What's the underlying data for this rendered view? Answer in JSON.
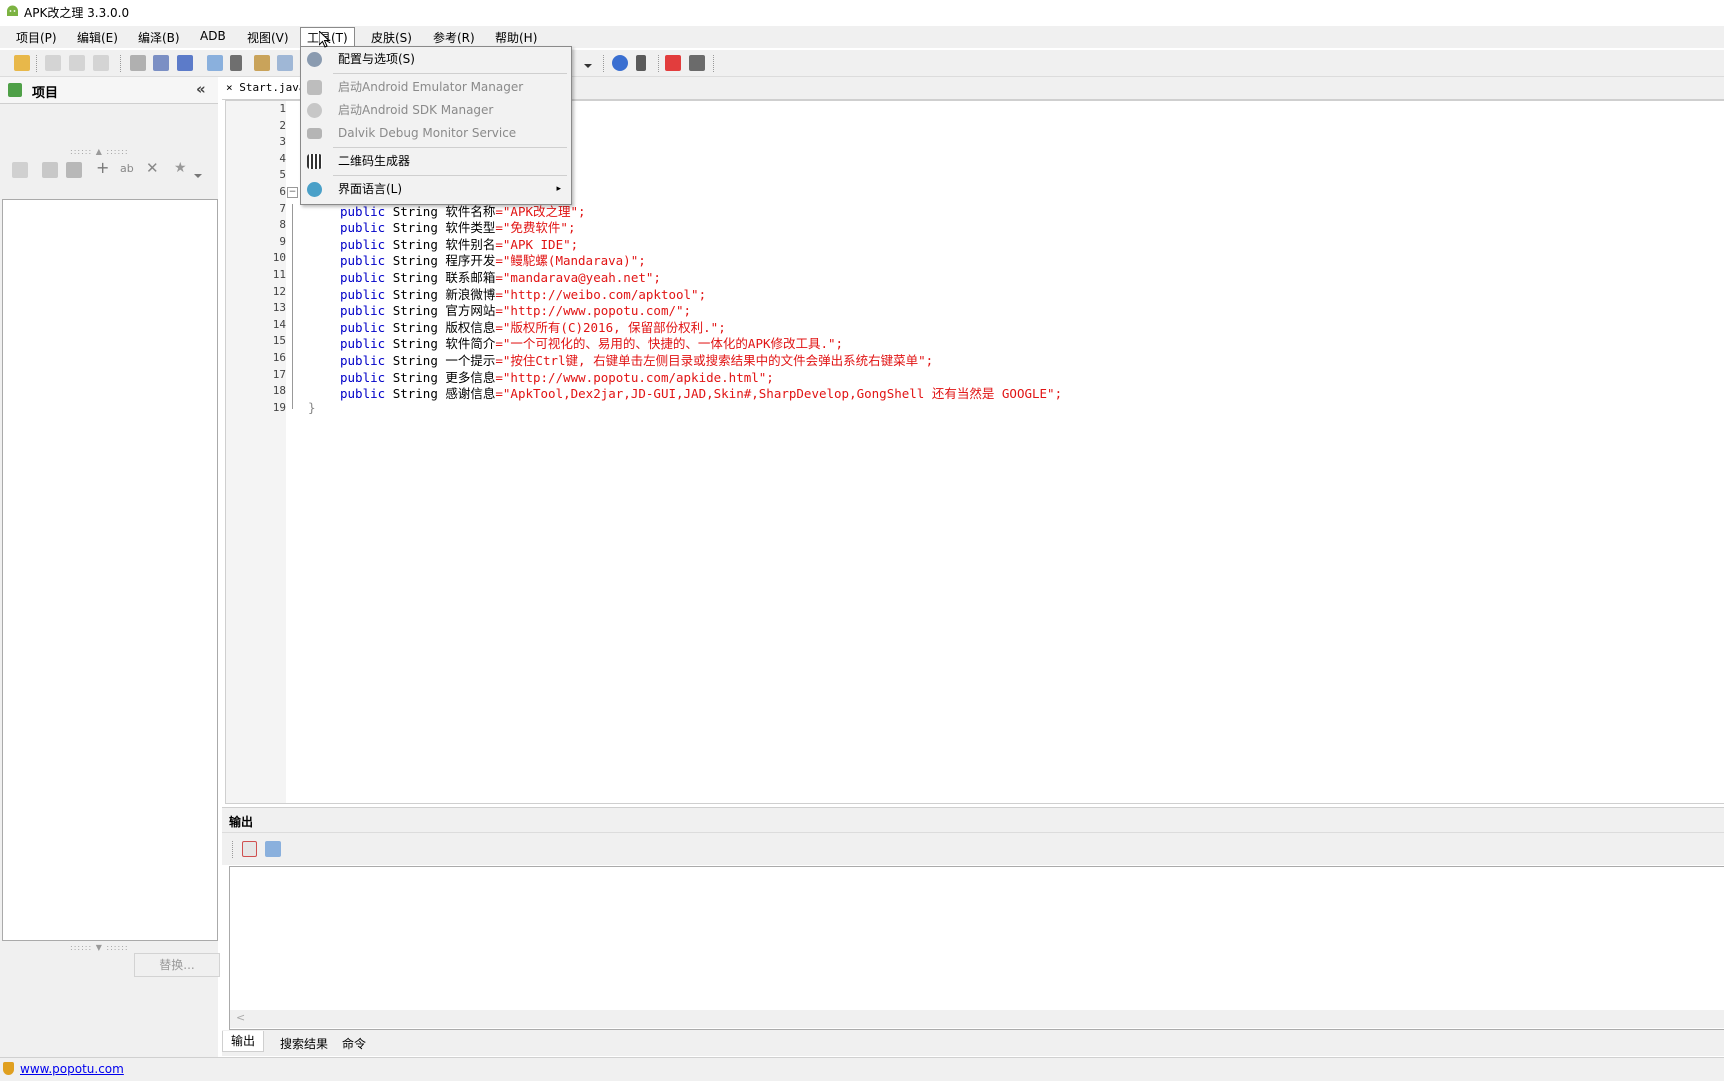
{
  "window": {
    "title": "APK改之理 3.3.0.0"
  },
  "menubar": {
    "items": [
      "项目(P)",
      "编辑(E)",
      "编泽(B)",
      "ADB",
      "视图(V)",
      "工具(T)",
      "皮肤(S)",
      "参考(R)",
      "帮助(H)"
    ]
  },
  "tools_menu": {
    "items": [
      {
        "label": "配置与选项(S)",
        "enabled": true,
        "icon": "gear-icon"
      },
      {
        "label": "启动Android Emulator Manager",
        "enabled": false,
        "icon": "phone-icon"
      },
      {
        "label": "启动Android SDK Manager",
        "enabled": false,
        "icon": "sdk-icon"
      },
      {
        "label": "Dalvik Debug Monitor Service",
        "enabled": false,
        "icon": "monitor-icon"
      },
      {
        "label": "二维码生成器",
        "enabled": true,
        "icon": "qrcode-icon"
      },
      {
        "label": "界面语言(L)",
        "enabled": true,
        "icon": "globe-icon",
        "submenu_arrow": "▸"
      }
    ]
  },
  "left_panel": {
    "title": "项目",
    "collapse_glyph": "«",
    "replace_button": "替换..."
  },
  "editor": {
    "tab_label": "Start.java",
    "tab_close": "×",
    "line_numbers": [
      "1",
      "2",
      "3",
      "4",
      "5",
      "6",
      "7",
      "8",
      "9",
      "10",
      "11",
      "12",
      "13",
      "14",
      "15",
      "16",
      "17",
      "18",
      "19"
    ],
    "lines": [
      {
        "n": 7,
        "kw": "public",
        "type": "String",
        "name": "软件名称",
        "value": "=\"APK改之理\";"
      },
      {
        "n": 8,
        "kw": "public",
        "type": "String",
        "name": "软件类型",
        "value": "=\"免费软件\";"
      },
      {
        "n": 9,
        "kw": "public",
        "type": "String",
        "name": "软件别名",
        "value": "=\"APK IDE\";"
      },
      {
        "n": 10,
        "kw": "public",
        "type": "String",
        "name": "程序开发",
        "value": "=\"鳗駝螺(Mandarava)\";"
      },
      {
        "n": 11,
        "kw": "public",
        "type": "String",
        "name": "联系邮箱",
        "value": "=\"mandarava@yeah.net\";"
      },
      {
        "n": 12,
        "kw": "public",
        "type": "String",
        "name": "新浪微博",
        "value": "=\"http://weibo.com/apktool\";"
      },
      {
        "n": 13,
        "kw": "public",
        "type": "String",
        "name": "官方网站",
        "value": "=\"http://www.popotu.com/\";"
      },
      {
        "n": 14,
        "kw": "public",
        "type": "String",
        "name": "版权信息",
        "value": "=\"版权所有(C)2016, 保留部份权利.\";"
      },
      {
        "n": 15,
        "kw": "public",
        "type": "String",
        "name": "软件简介",
        "value": "=\"一个可视化的、易用的、快捷的、一体化的APK修改工具.\";"
      },
      {
        "n": 16,
        "kw": "public",
        "type": "String",
        "name": "一个提示",
        "value": "=\"按住Ctrl键, 右键单击左侧目录或搜索结果中的文件会弹出系统右键菜单\";"
      },
      {
        "n": 17,
        "kw": "public",
        "type": "String",
        "name": "更多信息",
        "value": "=\"http://www.popotu.com/apkide.html\";"
      },
      {
        "n": 18,
        "kw": "public",
        "type": "String",
        "name": "感谢信息",
        "value": "=\"ApkTool,Dex2jar,JD-GUI,JAD,Skin#,SharpDevelop,GongShell 还有当然是 GOOGLE\";"
      }
    ],
    "closing_brace": "}"
  },
  "output": {
    "title": "输出",
    "tabs": [
      "输出",
      "搜索结果",
      "命令"
    ],
    "scroll_left_glyph": "<"
  },
  "statusbar": {
    "link": "www.popotu.com"
  },
  "colors": {
    "keyword": "#0000c8",
    "string": "#e11414",
    "chrome": "#f0f0f0"
  }
}
